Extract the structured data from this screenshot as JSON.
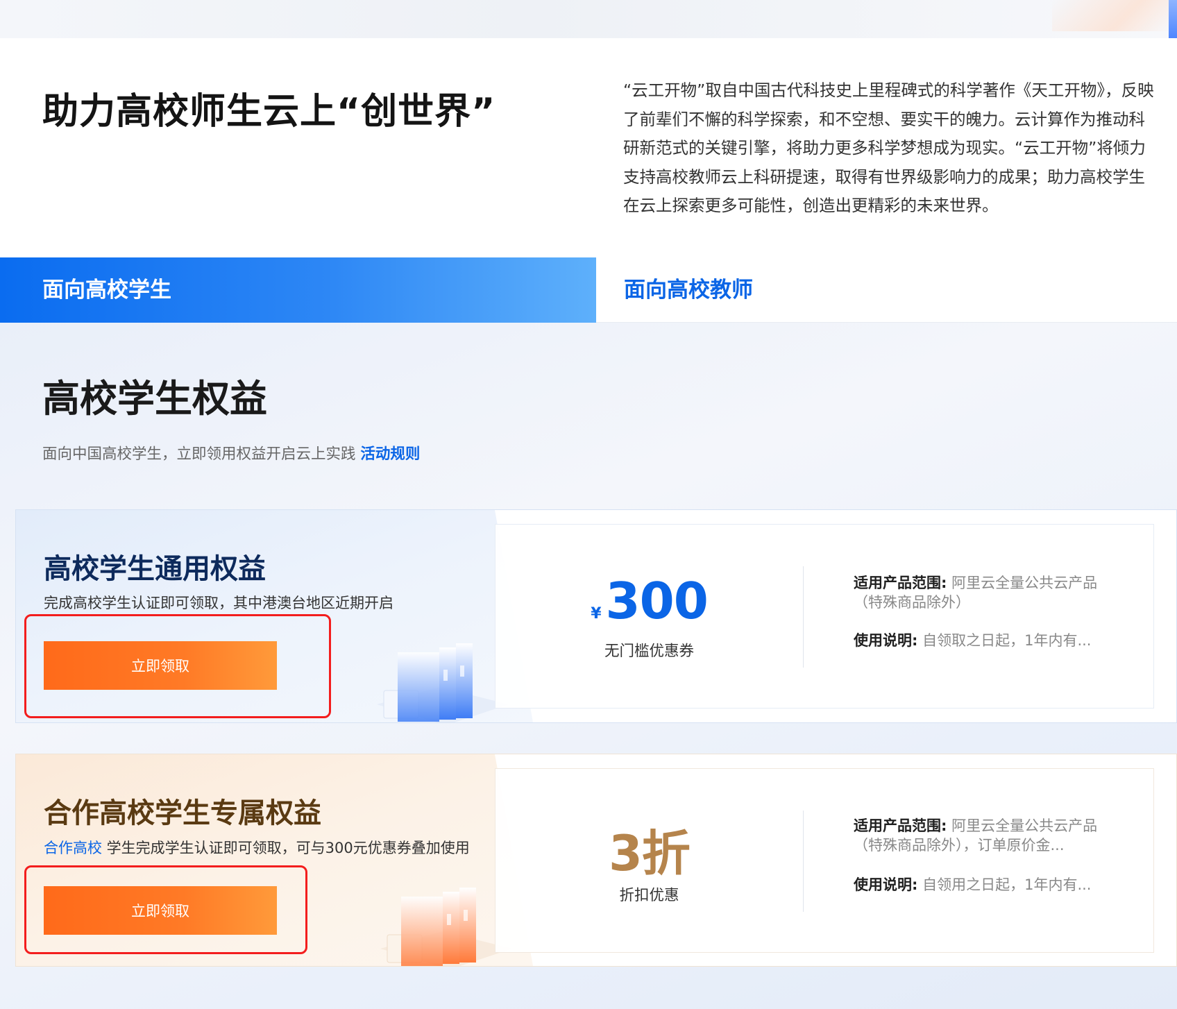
{
  "hero": {
    "title": "助力高校师生云上“创世界”",
    "description": "“云工开物”取自中国古代科技史上里程碑式的科学著作《天工开物》，反映了前辈们不懈的科学探索，和不空想、要实干的魄力。云计算作为推动科研新范式的关键引擎，将助力更多科学梦想成为现实。“云工开物”将倾力支持高校教师云上科研提速，取得有世界级影响力的成果；助力高校学生在云上探索更多可能性，创造出更精彩的未来世界。"
  },
  "tabs": [
    {
      "label": "面向高校学生",
      "active": true
    },
    {
      "label": "面向高校教师",
      "active": false
    }
  ],
  "section": {
    "title": "高校学生权益",
    "subtitle": "面向中国高校学生，立即领用权益开启云上实践",
    "rules_link": "活动规则"
  },
  "cards": [
    {
      "title": "高校学生通用权益",
      "description": "完成高校学生认证即可领取，其中港澳台地区近期开启",
      "button": "立即领取",
      "currency": "¥",
      "amount": "300",
      "amount_label": "无门槛优惠券",
      "scope_label": "适用产品范围:",
      "scope_text": "阿里云全量公共云产品（特殊商品除外）",
      "usage_label": "使用说明:",
      "usage_text": "自领取之日起，1年内有...",
      "accent": "#0b65e6"
    },
    {
      "title": "合作高校学生专属权益",
      "description_link": "合作高校",
      "description": " 学生完成学生认证即可领取，可与300元优惠券叠加使用",
      "button": "立即领取",
      "amount": "3折",
      "amount_label": "折扣优惠",
      "scope_label": "适用产品范围:",
      "scope_text": "阿里云全量公共云产品（特殊商品除外），订单原价金...",
      "usage_label": "使用说明:",
      "usage_text": "自领用之日起，1年内有...",
      "accent": "#b5844c"
    }
  ],
  "colors": {
    "primary_blue": "#0b65e6",
    "button_orange": "#ff6a1a",
    "highlight_red": "#f31d1d"
  }
}
